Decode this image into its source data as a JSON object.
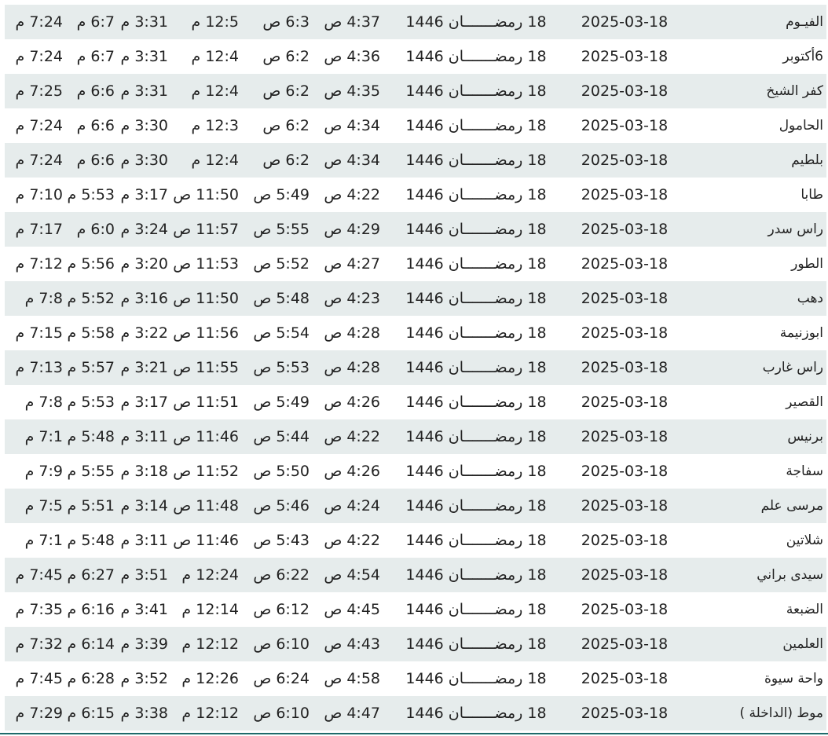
{
  "table": {
    "rows": [
      {
        "city": "الفيـوم",
        "gregorian": "2025-03-18",
        "hijri": "18 رمضـــــــان 1446",
        "fajr": "4:37 ص",
        "sunrise": "6:3 ص",
        "dhuhr": "12:5 م",
        "asr": "3:31 م",
        "maghrib": "6:7 م",
        "isha": "7:24 م"
      },
      {
        "city": "6أكتوبر",
        "gregorian": "2025-03-18",
        "hijri": "18 رمضـــــــان 1446",
        "fajr": "4:36 ص",
        "sunrise": "6:2 ص",
        "dhuhr": "12:4 م",
        "asr": "3:31 م",
        "maghrib": "6:7 م",
        "isha": "7:24 م"
      },
      {
        "city": "كفر الشيخ",
        "gregorian": "2025-03-18",
        "hijri": "18 رمضـــــــان 1446",
        "fajr": "4:35 ص",
        "sunrise": "6:2 ص",
        "dhuhr": "12:4 م",
        "asr": "3:31 م",
        "maghrib": "6:6 م",
        "isha": "7:25 م"
      },
      {
        "city": "الحامول",
        "gregorian": "2025-03-18",
        "hijri": "18 رمضـــــــان 1446",
        "fajr": "4:34 ص",
        "sunrise": "6:2 ص",
        "dhuhr": "12:3 م",
        "asr": "3:30 م",
        "maghrib": "6:6 م",
        "isha": "7:24 م"
      },
      {
        "city": "بلطيم",
        "gregorian": "2025-03-18",
        "hijri": "18 رمضـــــــان 1446",
        "fajr": "4:34 ص",
        "sunrise": "6:2 ص",
        "dhuhr": "12:4 م",
        "asr": "3:30 م",
        "maghrib": "6:6 م",
        "isha": "7:24 م"
      },
      {
        "city": "طابا",
        "gregorian": "2025-03-18",
        "hijri": "18 رمضـــــــان 1446",
        "fajr": "4:22 ص",
        "sunrise": "5:49 ص",
        "dhuhr": "11:50 ص",
        "asr": "3:17 م",
        "maghrib": "5:53 م",
        "isha": "7:10 م"
      },
      {
        "city": "راس سدر",
        "gregorian": "2025-03-18",
        "hijri": "18 رمضـــــــان 1446",
        "fajr": "4:29 ص",
        "sunrise": "5:55 ص",
        "dhuhr": "11:57 ص",
        "asr": "3:24 م",
        "maghrib": "6:0 م",
        "isha": "7:17 م"
      },
      {
        "city": "الطور",
        "gregorian": "2025-03-18",
        "hijri": "18 رمضـــــــان 1446",
        "fajr": "4:27 ص",
        "sunrise": "5:52 ص",
        "dhuhr": "11:53 ص",
        "asr": "3:20 م",
        "maghrib": "5:56 م",
        "isha": "7:12 م"
      },
      {
        "city": "دهب",
        "gregorian": "2025-03-18",
        "hijri": "18 رمضـــــــان 1446",
        "fajr": "4:23 ص",
        "sunrise": "5:48 ص",
        "dhuhr": "11:50 ص",
        "asr": "3:16 م",
        "maghrib": "5:52 م",
        "isha": "7:8 م"
      },
      {
        "city": "ابوزنيمة",
        "gregorian": "2025-03-18",
        "hijri": "18 رمضـــــــان 1446",
        "fajr": "4:28 ص",
        "sunrise": "5:54 ص",
        "dhuhr": "11:56 ص",
        "asr": "3:22 م",
        "maghrib": "5:58 م",
        "isha": "7:15 م"
      },
      {
        "city": "راس غارب",
        "gregorian": "2025-03-18",
        "hijri": "18 رمضـــــــان 1446",
        "fajr": "4:28 ص",
        "sunrise": "5:53 ص",
        "dhuhr": "11:55 ص",
        "asr": "3:21 م",
        "maghrib": "5:57 م",
        "isha": "7:13 م"
      },
      {
        "city": "القصير",
        "gregorian": "2025-03-18",
        "hijri": "18 رمضـــــــان 1446",
        "fajr": "4:26 ص",
        "sunrise": "5:49 ص",
        "dhuhr": "11:51 ص",
        "asr": "3:17 م",
        "maghrib": "5:53 م",
        "isha": "7:8 م"
      },
      {
        "city": "برنيس",
        "gregorian": "2025-03-18",
        "hijri": "18 رمضـــــــان 1446",
        "fajr": "4:22 ص",
        "sunrise": "5:44 ص",
        "dhuhr": "11:46 ص",
        "asr": "3:11 م",
        "maghrib": "5:48 م",
        "isha": "7:1 م"
      },
      {
        "city": "سفاجة",
        "gregorian": "2025-03-18",
        "hijri": "18 رمضـــــــان 1446",
        "fajr": "4:26 ص",
        "sunrise": "5:50 ص",
        "dhuhr": "11:52 ص",
        "asr": "3:18 م",
        "maghrib": "5:55 م",
        "isha": "7:9 م"
      },
      {
        "city": "مرسى علم",
        "gregorian": "2025-03-18",
        "hijri": "18 رمضـــــــان 1446",
        "fajr": "4:24 ص",
        "sunrise": "5:46 ص",
        "dhuhr": "11:48 ص",
        "asr": "3:14 م",
        "maghrib": "5:51 م",
        "isha": "7:5 م"
      },
      {
        "city": "شلاتين",
        "gregorian": "2025-03-18",
        "hijri": "18 رمضـــــــان 1446",
        "fajr": "4:22 ص",
        "sunrise": "5:43 ص",
        "dhuhr": "11:46 ص",
        "asr": "3:11 م",
        "maghrib": "5:48 م",
        "isha": "7:1 م"
      },
      {
        "city": "سيدى براني",
        "gregorian": "2025-03-18",
        "hijri": "18 رمضـــــــان 1446",
        "fajr": "4:54 ص",
        "sunrise": "6:22 ص",
        "dhuhr": "12:24 م",
        "asr": "3:51 م",
        "maghrib": "6:27 م",
        "isha": "7:45 م"
      },
      {
        "city": "الضبعة",
        "gregorian": "2025-03-18",
        "hijri": "18 رمضـــــــان 1446",
        "fajr": "4:45 ص",
        "sunrise": "6:12 ص",
        "dhuhr": "12:14 م",
        "asr": "3:41 م",
        "maghrib": "6:16 م",
        "isha": "7:35 م"
      },
      {
        "city": "العلمين",
        "gregorian": "2025-03-18",
        "hijri": "18 رمضـــــــان 1446",
        "fajr": "4:43 ص",
        "sunrise": "6:10 ص",
        "dhuhr": "12:12 م",
        "asr": "3:39 م",
        "maghrib": "6:14 م",
        "isha": "7:32 م"
      },
      {
        "city": "واحة سيوة",
        "gregorian": "2025-03-18",
        "hijri": "18 رمضـــــــان 1446",
        "fajr": "4:58 ص",
        "sunrise": "6:24 ص",
        "dhuhr": "12:26 م",
        "asr": "3:52 م",
        "maghrib": "6:28 م",
        "isha": "7:45 م"
      },
      {
        "city": "موط (الداخلة )",
        "gregorian": "2025-03-18",
        "hijri": "18 رمضـــــــان 1446",
        "fajr": "4:47 ص",
        "sunrise": "6:10 ص",
        "dhuhr": "12:12 م",
        "asr": "3:38 م",
        "maghrib": "6:15 م",
        "isha": "7:29 م"
      }
    ]
  },
  "colors": {
    "stripe": "#e6ecec",
    "text": "#222222",
    "bottom_border": "#1f6b6b"
  }
}
